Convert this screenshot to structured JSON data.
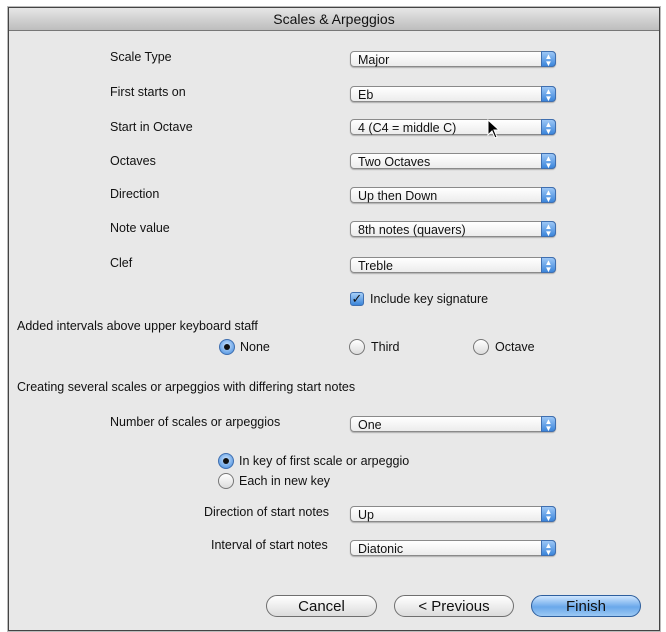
{
  "window": {
    "title": "Scales & Arpeggios"
  },
  "fields": [
    {
      "label": "Scale Type",
      "value": "Major"
    },
    {
      "label": "First starts on",
      "value": "Eb"
    },
    {
      "label": "Start in Octave",
      "value": "4 (C4 = middle C)"
    },
    {
      "label": "Octaves",
      "value": "Two Octaves"
    },
    {
      "label": "Direction",
      "value": "Up then Down"
    },
    {
      "label": "Note value",
      "value": "8th notes (quavers)"
    },
    {
      "label": "Clef",
      "value": "Treble"
    }
  ],
  "include_key_signature": {
    "label": "Include key signature",
    "checked": true
  },
  "intervals": {
    "heading": "Added intervals above upper keyboard staff",
    "options": [
      "None",
      "Third",
      "Octave"
    ],
    "selected": "None"
  },
  "several": {
    "heading": "Creating several scales or arpeggios with differing start notes",
    "number": {
      "label": "Number of scales or arpeggios",
      "value": "One"
    },
    "key_options": [
      "In key of first scale or arpeggio",
      "Each in new key"
    ],
    "key_selected": "In key of first scale or arpeggio",
    "direction": {
      "label": "Direction of start notes",
      "value": "Up"
    },
    "interval": {
      "label": "Interval of start notes",
      "value": "Diatonic"
    }
  },
  "buttons": {
    "cancel": "Cancel",
    "previous": "< Previous",
    "finish": "Finish"
  },
  "colors": {
    "accent": "#3c86db",
    "window_bg": "#e8e8e8"
  }
}
